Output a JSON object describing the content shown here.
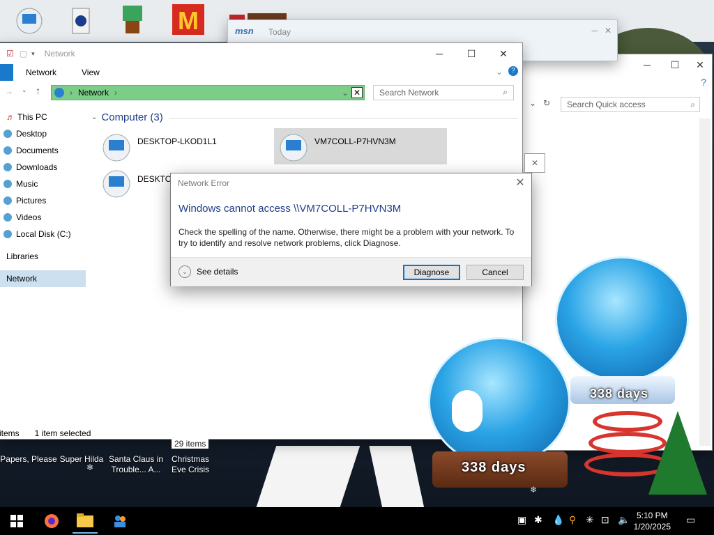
{
  "desktop": {
    "icons": [
      {
        "label": "Papers, Please"
      },
      {
        "label": "Super Hilda"
      },
      {
        "label": "Santa Claus in Trouble... A..."
      },
      {
        "label": "Christmas Eve Crisis"
      }
    ],
    "globe_days": "338 days",
    "globe_days_large": "338 days"
  },
  "msn_window": {
    "logo": "msn",
    "title": "Today"
  },
  "back_explorer": {
    "search_placeholder": "Search Quick access"
  },
  "explorer": {
    "title": "Network",
    "ribbon": {
      "tabs": [
        "Network",
        "View"
      ]
    },
    "address": {
      "location": "Network"
    },
    "search_placeholder": "Search Network",
    "sidebar": [
      {
        "label": "This PC"
      },
      {
        "label": "Desktop"
      },
      {
        "label": "Documents"
      },
      {
        "label": "Downloads"
      },
      {
        "label": "Music"
      },
      {
        "label": "Pictures"
      },
      {
        "label": "Videos"
      },
      {
        "label": "Local Disk (C:)"
      },
      {
        "label": "Libraries"
      },
      {
        "label": "Network"
      }
    ],
    "group_label": "Computer (3)",
    "computers": [
      {
        "name": "DESKTOP-LKOD1L1"
      },
      {
        "name": "VM7COLL-P7HVN3M"
      },
      {
        "name": "DESKTOP"
      }
    ],
    "status": {
      "items": "items",
      "selected": "1 item selected",
      "count": "29 items"
    }
  },
  "dialog": {
    "title": "Network Error",
    "heading": "Windows cannot access \\\\VM7COLL-P7HVN3M",
    "body": "Check the spelling of the name. Otherwise, there might be a problem with your network. To try to identify and resolve network problems, click Diagnose.",
    "details": "See details",
    "diagnose": "Diagnose",
    "cancel": "Cancel"
  },
  "taskbar": {
    "time": "5:10 PM",
    "date": "1/20/2025"
  },
  "colors": {
    "accent": "#0078d7",
    "address_bar": "#7ccd88",
    "heading_blue": "#1e3d8a",
    "ribbon_file": "#1979ca"
  }
}
